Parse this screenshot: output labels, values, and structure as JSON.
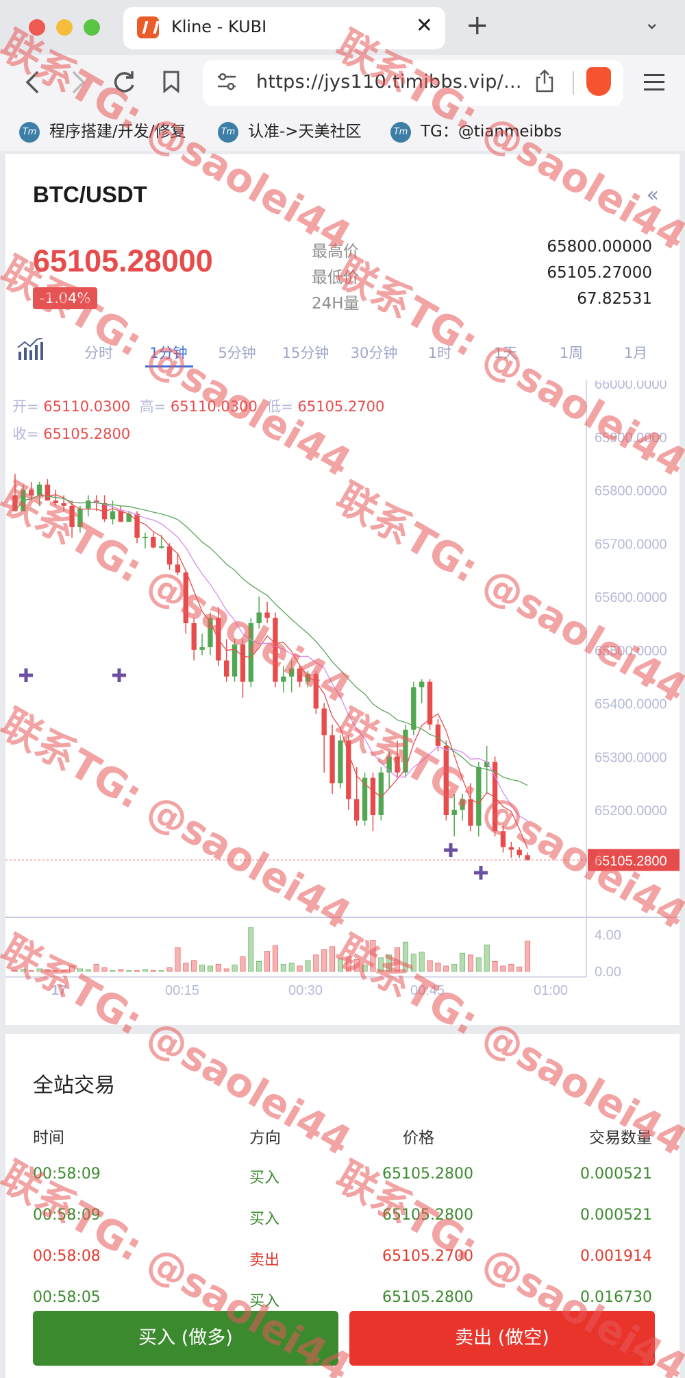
{
  "browser": {
    "tab_title": "Kline - KUBI",
    "tab_close": "✕",
    "new_tab": "+",
    "tab_menu": "⌄",
    "url": "https://jys110.timibbs.vip/...",
    "bookmarks": [
      {
        "label": "程序搭建/开发/修复",
        "icon_text": "Tm"
      },
      {
        "label": "认准->天美社区",
        "icon_text": "Tm"
      },
      {
        "label": "TG：@tianmeibbs",
        "icon_text": "Tm"
      }
    ]
  },
  "ticker": {
    "pair": "BTC/USDT",
    "collapse_icon": "«",
    "price": "65105.28000",
    "change": "-1.04%",
    "high_label": "最高价",
    "high_value": "65800.00000",
    "low_label": "最低价",
    "low_value": "65105.27000",
    "vol_label": "24H量",
    "vol_value": "67.82531"
  },
  "intervals": [
    "分时",
    "1分钟",
    "5分钟",
    "15分钟",
    "30分钟",
    "1时",
    "1天",
    "1周",
    "1月"
  ],
  "active_interval": "1分钟",
  "ohlc": {
    "open_label": "开=",
    "open": "65110.0300",
    "high_label": "高=",
    "high": "65110.0300",
    "low_label": "低=",
    "low": "65105.2700",
    "close_label": "收=",
    "close": "65105.2800"
  },
  "chart_data": {
    "type": "candlestick",
    "y_axis_ticks": [
      "66000.0000",
      "65900.0000",
      "65800.0000",
      "65700.0000",
      "65600.0000",
      "65500.0000",
      "65400.0000",
      "65300.0000",
      "65200.0000"
    ],
    "ylim": [
      65100,
      66000
    ],
    "last_price_label": "65105.2800",
    "volume_ticks": [
      "4.00",
      "0.00"
    ],
    "x_ticks": [
      "17",
      "00:15",
      "00:30",
      "00:45",
      "01:00"
    ],
    "colors": {
      "up": "#52a852",
      "down": "#e74c4c",
      "ma_short": "#e74c4c",
      "ma_mid": "#d98cf0",
      "ma_long": "#56a656"
    },
    "candles": [
      {
        "o": 65790,
        "h": 65830,
        "l": 65760,
        "c": 65760
      },
      {
        "o": 65760,
        "h": 65810,
        "l": 65760,
        "c": 65800
      },
      {
        "o": 65800,
        "h": 65815,
        "l": 65780,
        "c": 65790
      },
      {
        "o": 65790,
        "h": 65815,
        "l": 65770,
        "c": 65810
      },
      {
        "o": 65810,
        "h": 65820,
        "l": 65780,
        "c": 65780
      },
      {
        "o": 65780,
        "h": 65800,
        "l": 65770,
        "c": 65775
      },
      {
        "o": 65775,
        "h": 65790,
        "l": 65760,
        "c": 65770
      },
      {
        "o": 65770,
        "h": 65780,
        "l": 65710,
        "c": 65730
      },
      {
        "o": 65730,
        "h": 65770,
        "l": 65720,
        "c": 65765
      },
      {
        "o": 65765,
        "h": 65790,
        "l": 65750,
        "c": 65780
      },
      {
        "o": 65780,
        "h": 65790,
        "l": 65760,
        "c": 65775
      },
      {
        "o": 65775,
        "h": 65790,
        "l": 65740,
        "c": 65745
      },
      {
        "o": 65745,
        "h": 65780,
        "l": 65735,
        "c": 65760
      },
      {
        "o": 65760,
        "h": 65770,
        "l": 65740,
        "c": 65740
      },
      {
        "o": 65740,
        "h": 65760,
        "l": 65740,
        "c": 65755
      },
      {
        "o": 65755,
        "h": 65760,
        "l": 65700,
        "c": 65710
      },
      {
        "o": 65710,
        "h": 65720,
        "l": 65690,
        "c": 65712
      },
      {
        "o": 65712,
        "h": 65720,
        "l": 65690,
        "c": 65692
      },
      {
        "o": 65692,
        "h": 65715,
        "l": 65690,
        "c": 65694
      },
      {
        "o": 65694,
        "h": 65700,
        "l": 65650,
        "c": 65660
      },
      {
        "o": 65660,
        "h": 65680,
        "l": 65640,
        "c": 65645
      },
      {
        "o": 65645,
        "h": 65650,
        "l": 65530,
        "c": 65550
      },
      {
        "o": 65550,
        "h": 65560,
        "l": 65480,
        "c": 65500
      },
      {
        "o": 65500,
        "h": 65530,
        "l": 65490,
        "c": 65505
      },
      {
        "o": 65505,
        "h": 65570,
        "l": 65490,
        "c": 65560
      },
      {
        "o": 65560,
        "h": 65580,
        "l": 65470,
        "c": 65480
      },
      {
        "o": 65480,
        "h": 65520,
        "l": 65440,
        "c": 65450
      },
      {
        "o": 65450,
        "h": 65520,
        "l": 65440,
        "c": 65510
      },
      {
        "o": 65510,
        "h": 65520,
        "l": 65410,
        "c": 65440
      },
      {
        "o": 65440,
        "h": 65560,
        "l": 65430,
        "c": 65550
      },
      {
        "o": 65550,
        "h": 65600,
        "l": 65540,
        "c": 65570
      },
      {
        "o": 65570,
        "h": 65590,
        "l": 65550,
        "c": 65560
      },
      {
        "o": 65560,
        "h": 65570,
        "l": 65430,
        "c": 65440
      },
      {
        "o": 65440,
        "h": 65470,
        "l": 65420,
        "c": 65450
      },
      {
        "o": 65450,
        "h": 65480,
        "l": 65420,
        "c": 65465
      },
      {
        "o": 65465,
        "h": 65470,
        "l": 65430,
        "c": 65440
      },
      {
        "o": 65440,
        "h": 65460,
        "l": 65430,
        "c": 65455
      },
      {
        "o": 65455,
        "h": 65460,
        "l": 65380,
        "c": 65390
      },
      {
        "o": 65390,
        "h": 65400,
        "l": 65270,
        "c": 65340
      },
      {
        "o": 65340,
        "h": 65360,
        "l": 65230,
        "c": 65250
      },
      {
        "o": 65250,
        "h": 65340,
        "l": 65240,
        "c": 65330
      },
      {
        "o": 65330,
        "h": 65340,
        "l": 65200,
        "c": 65220
      },
      {
        "o": 65220,
        "h": 65280,
        "l": 65170,
        "c": 65180
      },
      {
        "o": 65180,
        "h": 65270,
        "l": 65170,
        "c": 65260
      },
      {
        "o": 65260,
        "h": 65270,
        "l": 65160,
        "c": 65190
      },
      {
        "o": 65190,
        "h": 65280,
        "l": 65180,
        "c": 65270
      },
      {
        "o": 65270,
        "h": 65310,
        "l": 65240,
        "c": 65300
      },
      {
        "o": 65300,
        "h": 65330,
        "l": 65260,
        "c": 65270
      },
      {
        "o": 65270,
        "h": 65360,
        "l": 65260,
        "c": 65350
      },
      {
        "o": 65350,
        "h": 65440,
        "l": 65340,
        "c": 65430
      },
      {
        "o": 65430,
        "h": 65445,
        "l": 65400,
        "c": 65440
      },
      {
        "o": 65440,
        "h": 65445,
        "l": 65350,
        "c": 65360
      },
      {
        "o": 65360,
        "h": 65370,
        "l": 65310,
        "c": 65320
      },
      {
        "o": 65320,
        "h": 65330,
        "l": 65180,
        "c": 65190
      },
      {
        "o": 65190,
        "h": 65230,
        "l": 65150,
        "c": 65200
      },
      {
        "o": 65200,
        "h": 65230,
        "l": 65180,
        "c": 65220
      },
      {
        "o": 65220,
        "h": 65250,
        "l": 65160,
        "c": 65170
      },
      {
        "o": 65170,
        "h": 65290,
        "l": 65150,
        "c": 65280
      },
      {
        "o": 65280,
        "h": 65320,
        "l": 65230,
        "c": 65290
      },
      {
        "o": 65290,
        "h": 65300,
        "l": 65150,
        "c": 65160
      },
      {
        "o": 65160,
        "h": 65170,
        "l": 65120,
        "c": 65130
      },
      {
        "o": 65130,
        "h": 65140,
        "l": 65110,
        "c": 65125
      },
      {
        "o": 65125,
        "h": 65130,
        "l": 65110,
        "c": 65115
      },
      {
        "o": 65115,
        "h": 65120,
        "l": 65105,
        "c": 65106
      }
    ],
    "volumes": [
      0.1,
      0.2,
      0.1,
      0.3,
      0.2,
      0.1,
      0.1,
      0.6,
      0.3,
      0.2,
      0.8,
      0.4,
      0.1,
      0.2,
      0.1,
      0.1,
      0.2,
      0.1,
      0.1,
      0.4,
      2.6,
      0.9,
      1.2,
      0.7,
      0.6,
      0.8,
      0.3,
      0.7,
      1.6,
      4.8,
      1.1,
      2.2,
      2.8,
      0.8,
      0.9,
      0.6,
      1.2,
      1.8,
      2.4,
      2.7,
      1.4,
      1.6,
      1.3,
      0.7,
      3.4,
      1.5,
      1.8,
      2.6,
      3.2,
      1.9,
      2.1,
      1.2,
      0.9,
      0.6,
      0.8,
      2.0,
      1.8,
      1.5,
      2.9,
      1.1,
      0.6,
      0.8,
      0.5,
      3.3
    ],
    "volume_max": 5
  },
  "trades": {
    "title": "全站交易",
    "headers": [
      "时间",
      "方向",
      "价格",
      "交易数量"
    ],
    "rows": [
      {
        "time": "00:58:09",
        "side": "买入",
        "price": "65105.2800",
        "qty": "0.000521",
        "color": "#3b8a2e"
      },
      {
        "time": "00:58:09",
        "side": "买入",
        "price": "65105.2800",
        "qty": "0.000521",
        "color": "#3b8a2e"
      },
      {
        "time": "00:58:08",
        "side": "卖出",
        "price": "65105.2700",
        "qty": "0.001914",
        "color": "#e03a2e"
      },
      {
        "time": "00:58:05",
        "side": "买入",
        "price": "65105.2800",
        "qty": "0.016730",
        "color": "#3b8a2e"
      }
    ]
  },
  "actions": {
    "buy_label": "买入 (做多)",
    "buy_color": "#3b8a2e",
    "sell_label": "卖出 (做空)",
    "sell_color": "#e8342a"
  },
  "watermark": "联系TG: @saolei44"
}
